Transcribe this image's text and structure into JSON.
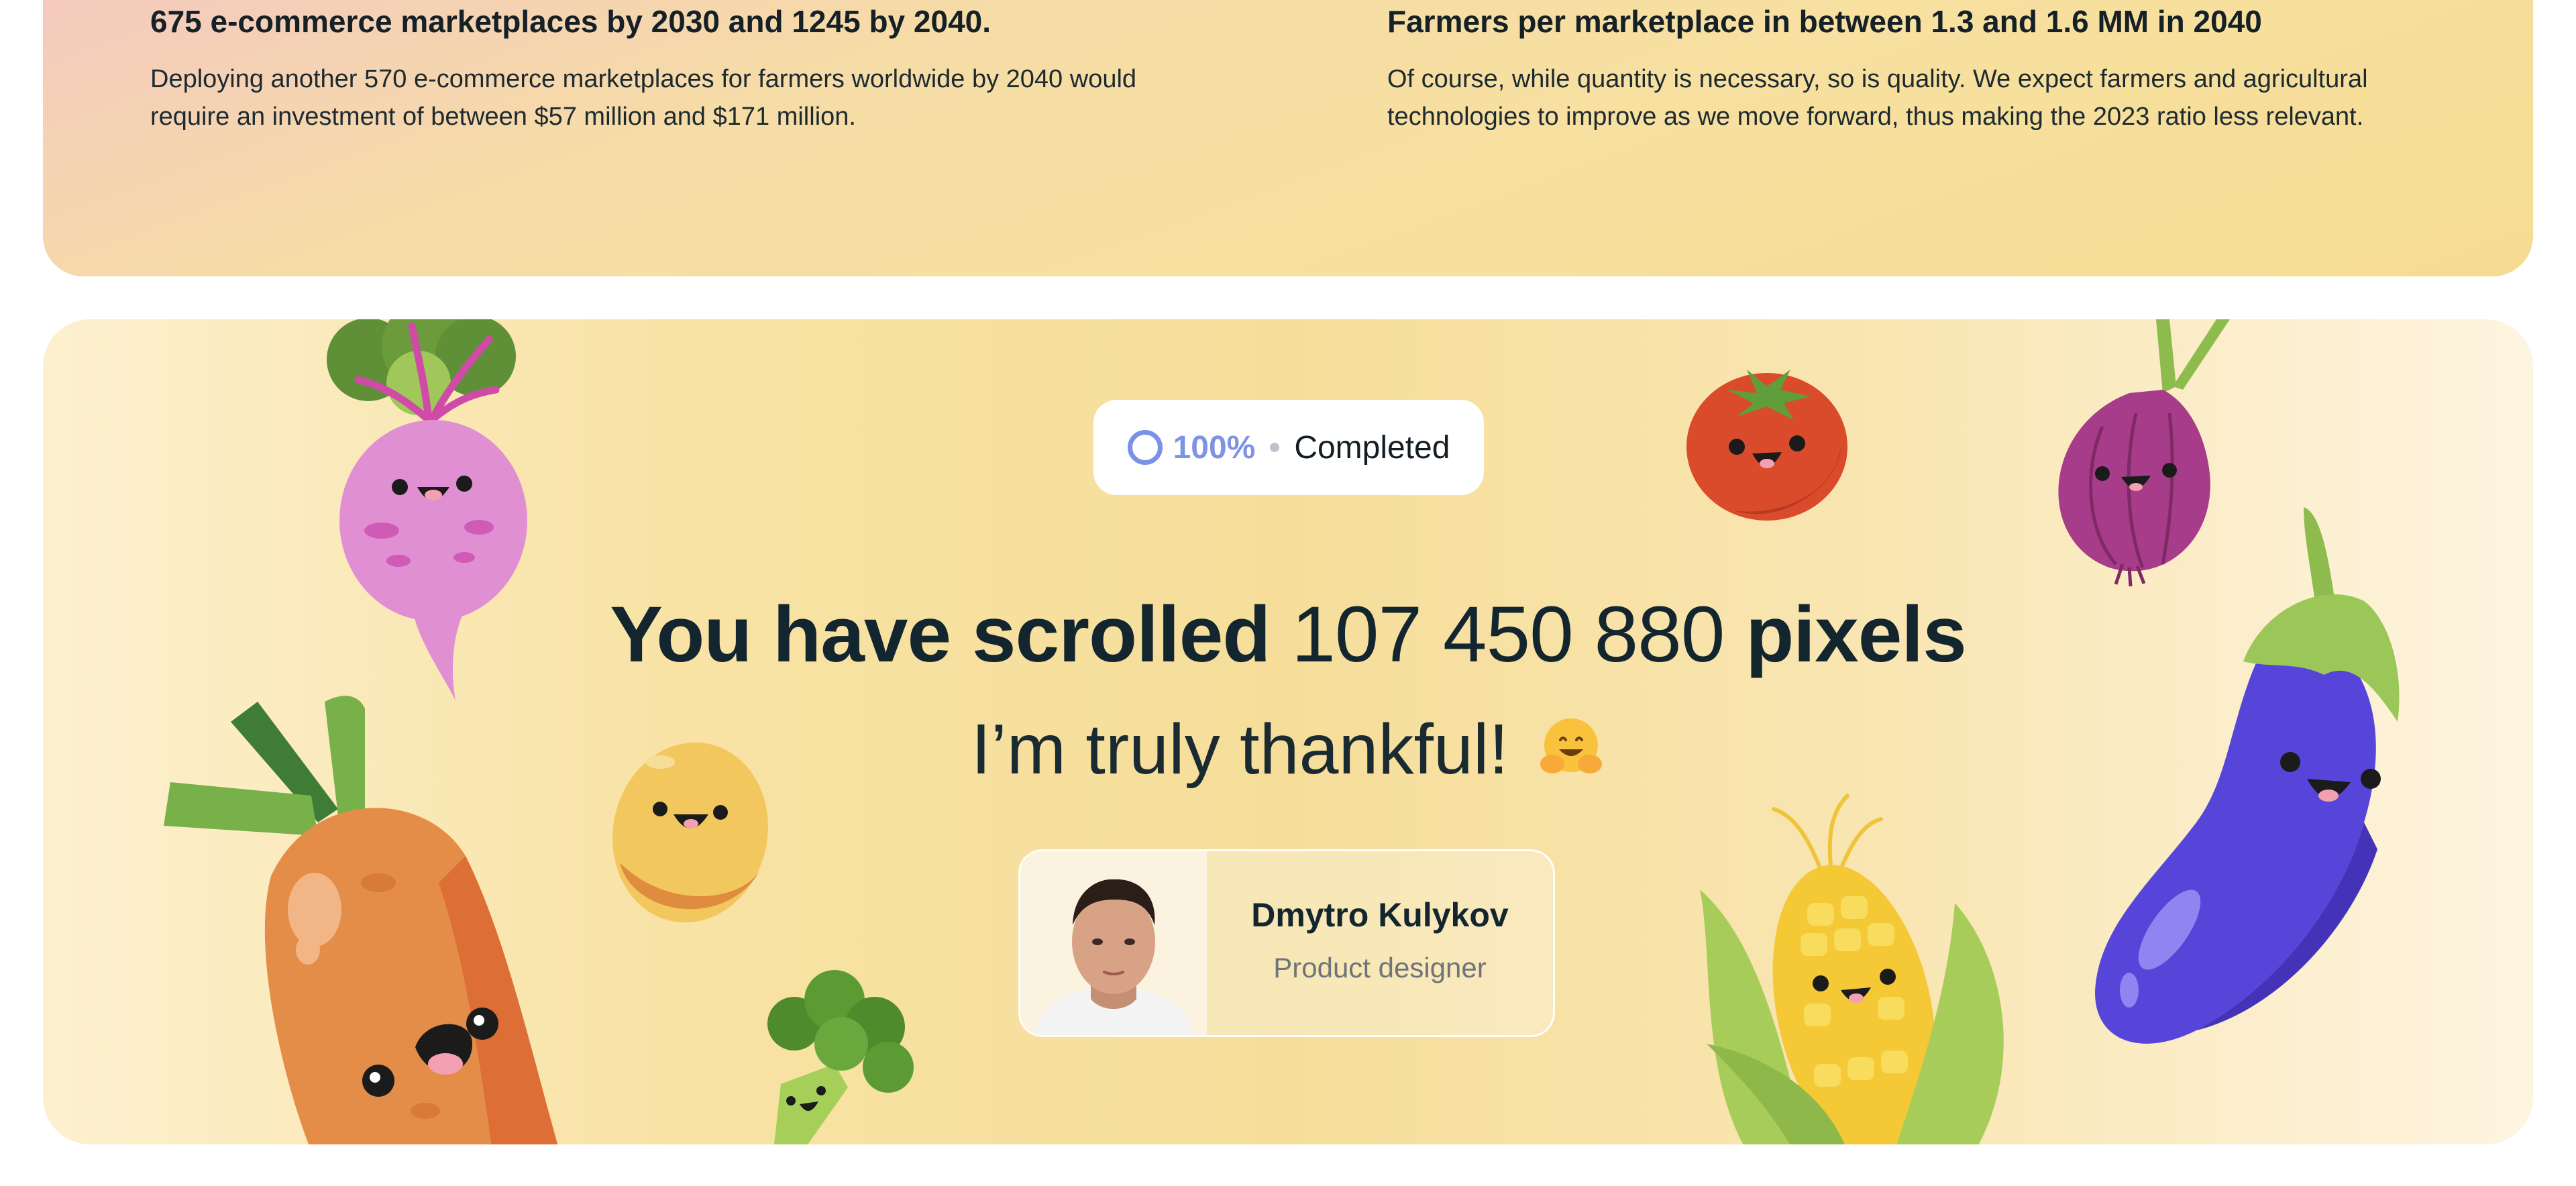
{
  "stats": [
    {
      "title": "675 e-commerce marketplaces by 2030 and 1245 by 2040.",
      "text": "Deploying another 570 e-commerce marketplaces for farmers worldwide by 2040 would require an investment of between $57 million and $171 million."
    },
    {
      "title": "Farmers per marketplace in between 1.3 and 1.6 MM in 2040",
      "text": "Of course, while quantity is necessary, so is quality. We expect farmers and agricultural technologies to improve as we move forward, thus making the 2023 ratio less relevant."
    }
  ],
  "progress": {
    "percent_label": "100%",
    "status": "Completed",
    "ring_color": "#7a91e8"
  },
  "headline": {
    "prefix": "You have scrolled",
    "number": "107 450 880",
    "suffix": "pixels"
  },
  "thanks": {
    "text": "I’m truly thankful!",
    "emoji": "hugging-face-emoji"
  },
  "author": {
    "name": "Dmytro Kulykov",
    "role": "Product designer"
  },
  "illustrations": [
    "beet",
    "carrot",
    "potato",
    "broccoli",
    "tomato",
    "onion",
    "corn",
    "eggplant"
  ]
}
